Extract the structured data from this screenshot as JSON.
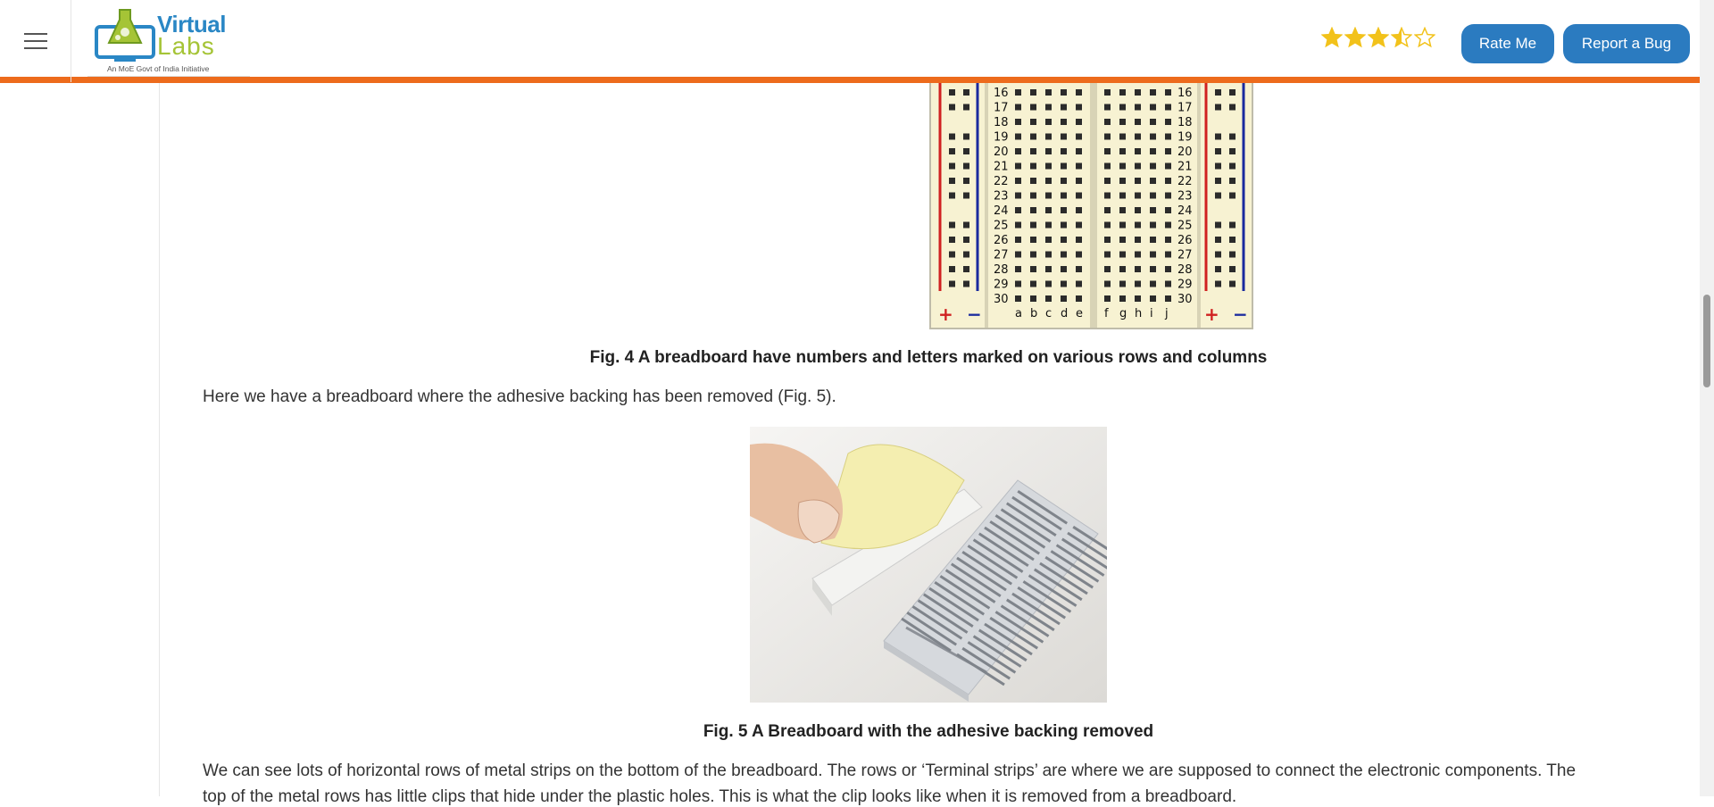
{
  "header": {
    "logo": {
      "word1": "Virtual",
      "word2": "Labs",
      "tagline": "An MoE Govt of India Initiative"
    },
    "rating": {
      "value": 3.5,
      "max": 5,
      "color": "#f2c21b"
    },
    "rate_button_label": "Rate Me",
    "bug_button_label": "Report a Bug",
    "accent_color": "#ed6b1c",
    "button_color": "#2b7bc0"
  },
  "breadboard": {
    "rows": [
      "16",
      "17",
      "18",
      "19",
      "20",
      "21",
      "22",
      "23",
      "24",
      "25",
      "26",
      "27",
      "28",
      "29",
      "30"
    ],
    "left_columns": [
      "a",
      "b",
      "c",
      "d",
      "e"
    ],
    "right_columns": [
      "f",
      "g",
      "h",
      "i",
      "j"
    ],
    "plus_symbol": "+",
    "minus_symbol": "−"
  },
  "content": {
    "fig4_caption": "Fig. 4 A breadboard have numbers and letters marked on various rows and columns",
    "paragraph1": "Here we have a breadboard where the adhesive backing has been removed (Fig. 5).",
    "fig5_caption": "Fig. 5 A Breadboard with the adhesive backing removed",
    "paragraph2": "We can see lots of horizontal rows of metal strips on the bottom of the breadboard. The rows or ‘Terminal strips’ are where we are supposed to connect the electronic components. The",
    "paragraph3": "top of the metal rows has little clips that hide under the plastic holes. This is what the clip looks like when it is removed from a breadboard."
  }
}
